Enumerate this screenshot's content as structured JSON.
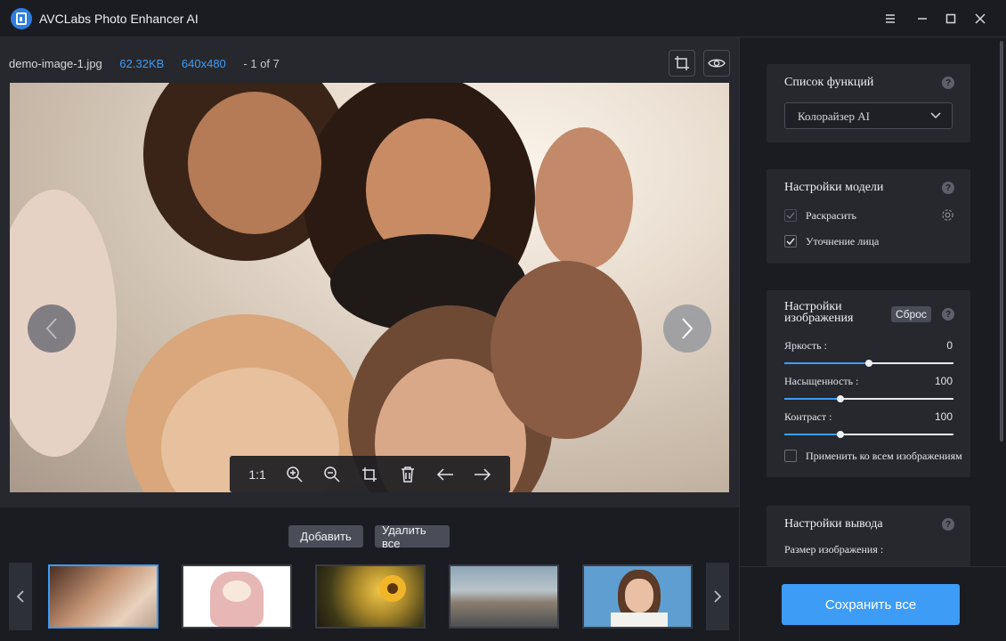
{
  "app": {
    "title": "AVCLabs Photo Enhancer AI"
  },
  "file": {
    "name": "demo-image-1.jpg",
    "size": "62.32KB",
    "dimensions": "640x480",
    "counter": "- 1 of 7"
  },
  "toolbar": {
    "ratio_label": "1:1"
  },
  "bottom": {
    "add_label": "Добавить",
    "delete_all_label": "Удалить все"
  },
  "panel": {
    "functions": {
      "title": "Список функций",
      "selected": "Колорайзер AI"
    },
    "model": {
      "title": "Настройки модели",
      "colorize_label": "Раскрасить",
      "face_label": "Уточнение лица"
    },
    "image": {
      "title": "Настройки изображения",
      "reset_label": "Сброс",
      "brightness": {
        "label": "Яркость :",
        "value": "0",
        "level": 0.5
      },
      "saturation": {
        "label": "Насыщенность :",
        "value": "100",
        "level": 0.33
      },
      "contrast": {
        "label": "Контраст :",
        "value": "100",
        "level": 0.33
      },
      "apply_all_label": "Применить ко всем изображениям"
    },
    "output": {
      "title": "Настройки вывода",
      "size_label": "Размер изображения :"
    },
    "save_label": "Сохранить все"
  },
  "colors": {
    "accent": "#3d9cf5",
    "bg": "#1b1c21",
    "panel": "#26282e"
  }
}
